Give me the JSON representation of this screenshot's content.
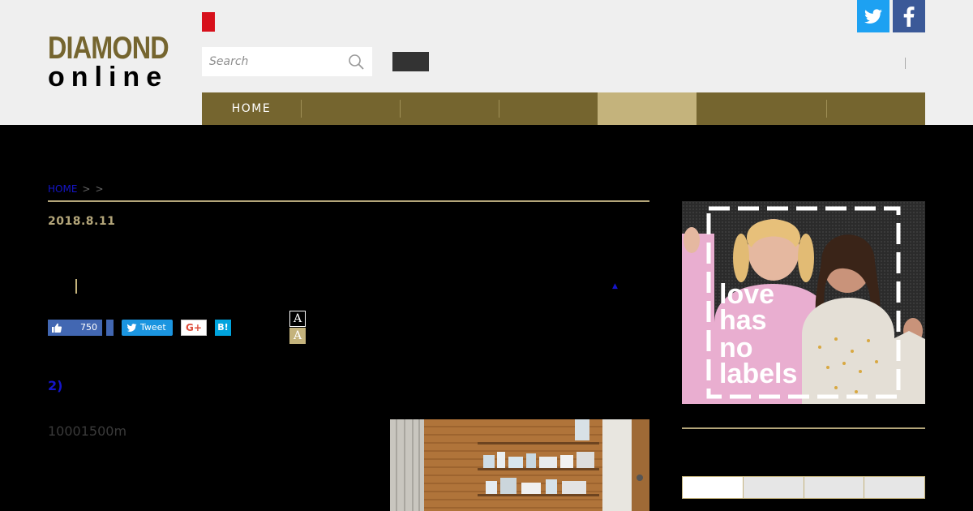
{
  "header": {
    "logo": {
      "line1": "DIAMOND",
      "line2": "online"
    },
    "search": {
      "placeholder": "Search"
    },
    "social": [
      {
        "name": "twitter",
        "icon": "twitter-icon",
        "color": "#1da1f2"
      },
      {
        "name": "facebook",
        "icon": "facebook-icon",
        "color": "#3b5998"
      }
    ]
  },
  "nav": {
    "items": [
      {
        "label": "HOME",
        "active": false
      },
      {
        "label": "",
        "active": false
      },
      {
        "label": "",
        "active": false
      },
      {
        "label": "",
        "active": false
      },
      {
        "label": "",
        "active": true
      },
      {
        "label": "",
        "active": false
      },
      {
        "label": "",
        "active": false
      }
    ]
  },
  "breadcrumb": {
    "home": "HOME",
    "sep1": ">",
    "sep2": ">"
  },
  "article": {
    "date": "2018.8.11",
    "share": {
      "like_count": "750",
      "tweet_label": "Tweet",
      "gplus_label": "G+",
      "hatena_label": "B!"
    },
    "font_size": {
      "normal": "A",
      "large": "A"
    },
    "heading": "2)",
    "body": "10001500m"
  },
  "ad": {
    "text_lines": [
      "love",
      "has",
      "no",
      "labels"
    ]
  },
  "colors": {
    "brand_gold": "#75652f",
    "accent_gold": "#c4b37c",
    "link_blue": "#1515c9",
    "header_bg": "#efefef"
  }
}
